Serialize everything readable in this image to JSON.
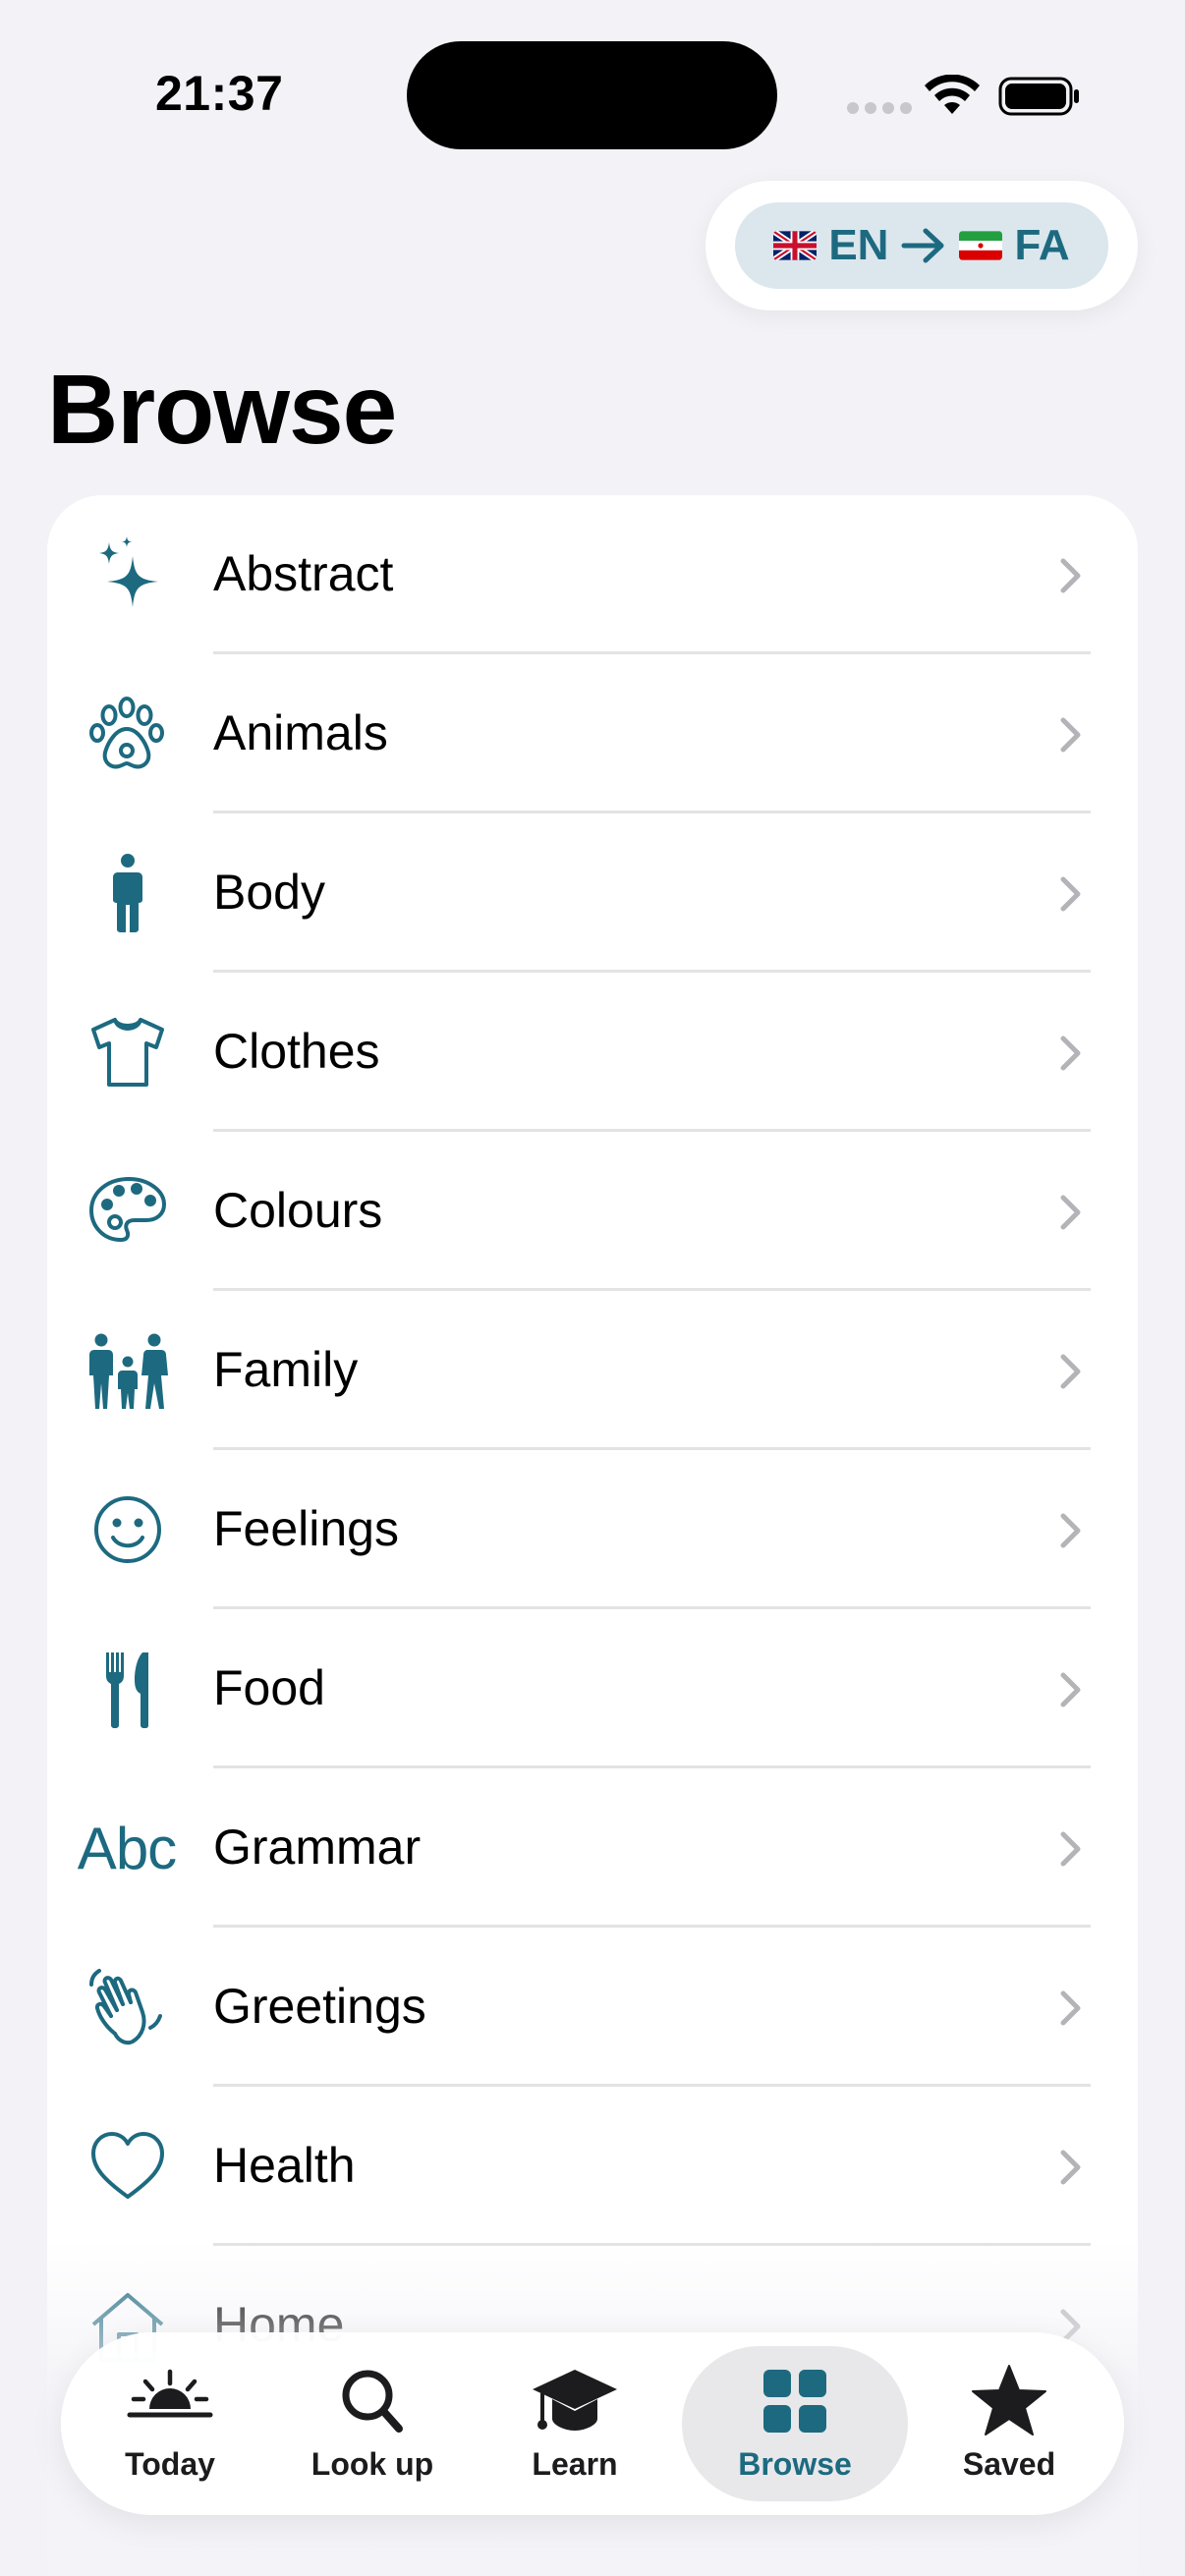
{
  "status_bar": {
    "time": "21:37"
  },
  "language": {
    "from_code": "EN",
    "to_code": "FA",
    "from_flag": "uk-flag-icon",
    "to_flag": "iran-flag-icon"
  },
  "page": {
    "title": "Browse"
  },
  "categories": [
    {
      "label": "Abstract",
      "icon": "sparkles-icon"
    },
    {
      "label": "Animals",
      "icon": "paw-icon"
    },
    {
      "label": "Body",
      "icon": "person-icon"
    },
    {
      "label": "Clothes",
      "icon": "tshirt-icon"
    },
    {
      "label": "Colours",
      "icon": "palette-icon"
    },
    {
      "label": "Family",
      "icon": "family-icon"
    },
    {
      "label": "Feelings",
      "icon": "smiley-icon"
    },
    {
      "label": "Food",
      "icon": "fork-knife-icon"
    },
    {
      "label": "Grammar",
      "icon": "abc-icon",
      "icon_text": "Abc"
    },
    {
      "label": "Greetings",
      "icon": "waving-hand-icon"
    },
    {
      "label": "Health",
      "icon": "heart-icon"
    },
    {
      "label": "Home",
      "icon": "house-icon"
    }
  ],
  "tabs": [
    {
      "label": "Today",
      "icon": "sunrise-icon",
      "active": false
    },
    {
      "label": "Look up",
      "icon": "magnifier-icon",
      "active": false
    },
    {
      "label": "Learn",
      "icon": "graduation-cap-icon",
      "active": false
    },
    {
      "label": "Browse",
      "icon": "grid-icon",
      "active": true
    },
    {
      "label": "Saved",
      "icon": "star-icon",
      "active": false
    }
  ],
  "colors": {
    "accent": "#1d6a80",
    "pill_bg": "#dbe7ed",
    "background": "#f2f2f7",
    "chevron": "#b4b4b8"
  }
}
